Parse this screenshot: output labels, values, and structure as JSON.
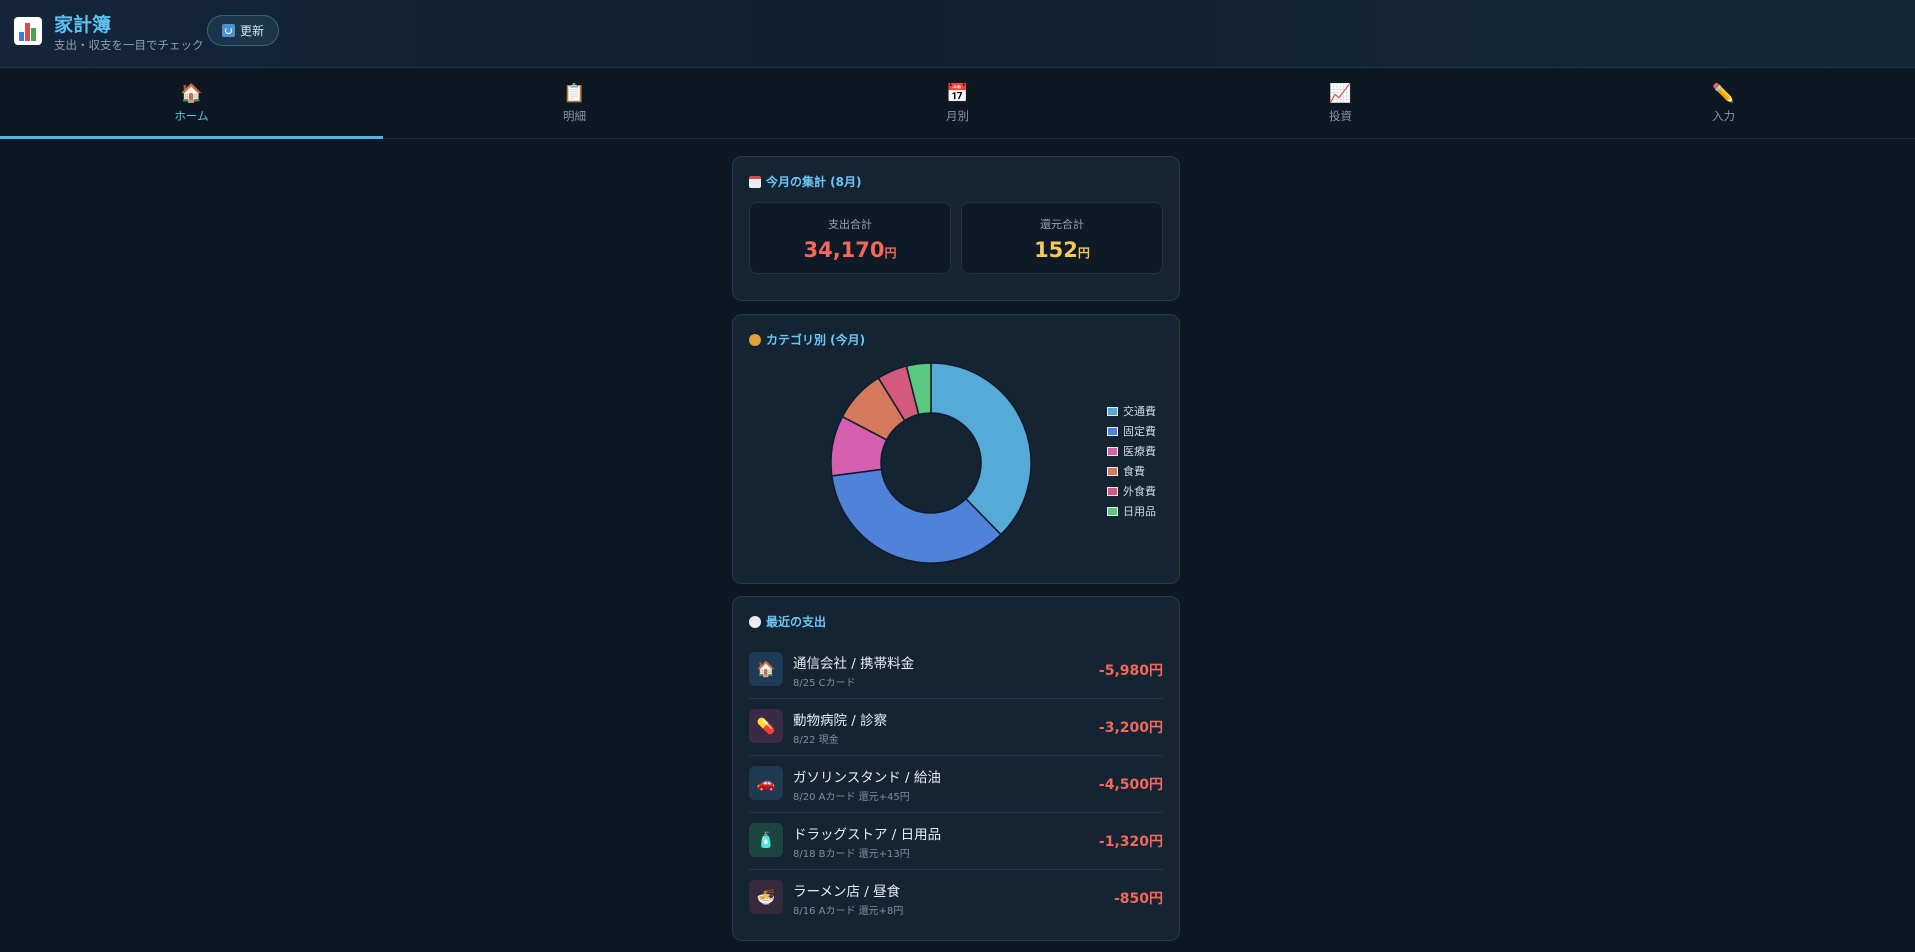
{
  "header": {
    "title": "家計簿",
    "subtitle": "支出・収支を一目でチェック",
    "refresh_label": "更新",
    "logo_icon": "bar-chart-icon",
    "refresh_icon": "refresh-icon"
  },
  "tabs": [
    {
      "label": "ホーム",
      "icon": "house-icon",
      "glyph": "🏠",
      "active": true
    },
    {
      "label": "明細",
      "icon": "clipboard-icon",
      "glyph": "📋",
      "active": false
    },
    {
      "label": "月別",
      "icon": "calendar-icon",
      "glyph": "📅",
      "active": false
    },
    {
      "label": "投資",
      "icon": "chart-up-icon",
      "glyph": "📈",
      "active": false
    },
    {
      "label": "入力",
      "icon": "pencil-icon",
      "glyph": "✏️",
      "active": false
    }
  ],
  "summary": {
    "title": "今月の集計 (8月)",
    "title_icon": "calendar-icon",
    "expense_label": "支出合計",
    "expense_value": "34,170",
    "expense_unit": "円",
    "return_label": "還元合計",
    "return_value": "152",
    "return_unit": "円"
  },
  "category": {
    "title": "カテゴリ別 (今月)",
    "title_icon": "compass-icon"
  },
  "chart_data": {
    "type": "pie",
    "donut": true,
    "legend_position": "right",
    "categories": [
      "交通費",
      "固定費",
      "医療費",
      "食費",
      "外食費",
      "日用品"
    ],
    "values": [
      12.4,
      11.6,
      3.2,
      2.8,
      1.6,
      1.3
    ],
    "colors": [
      "#56aad8",
      "#4f82d8",
      "#d45fae",
      "#d4795b",
      "#d35a7e",
      "#59c982"
    ]
  },
  "recent": {
    "title": "最近の支出",
    "title_icon": "clock-icon",
    "items": [
      {
        "name": "通信会社 / 携帯料金",
        "meta": "8/25 Cカード",
        "amount": "-5,980円",
        "icon": "house-icon",
        "glyph": "🏠",
        "icon_bg": "#1f3a57"
      },
      {
        "name": "動物病院 / 診察",
        "meta": "8/22 現金",
        "amount": "-3,200円",
        "icon": "pill-icon",
        "glyph": "💊",
        "icon_bg": "#3a2a45"
      },
      {
        "name": "ガソリンスタンド / 給油",
        "meta": "8/20 Aカード 還元+45円",
        "amount": "-4,500円",
        "icon": "car-icon",
        "glyph": "🚗",
        "icon_bg": "#1f3a50"
      },
      {
        "name": "ドラッグストア / 日用品",
        "meta": "8/18 Bカード 還元+13円",
        "amount": "-1,320円",
        "icon": "bottle-icon",
        "glyph": "🧴",
        "icon_bg": "#1d4540"
      },
      {
        "name": "ラーメン店 / 昼食",
        "meta": "8/16 Aカード 還元+8円",
        "amount": "-850円",
        "icon": "ramen-icon",
        "glyph": "🍜",
        "icon_bg": "#362a3a"
      }
    ]
  }
}
